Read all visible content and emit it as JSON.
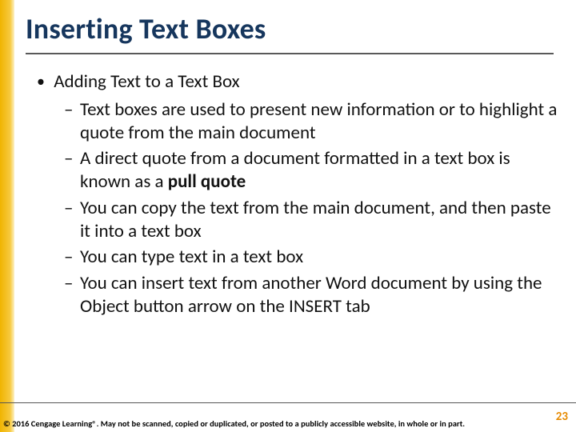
{
  "title": "Inserting Text Boxes",
  "content": {
    "l1": "Adding Text to a Text Box",
    "sub": [
      "Text boxes are used to present new information or to highlight a quote from the main document",
      "A direct quote from a document formatted in a text box is known as a ",
      "You can copy the text from the main document, and then paste it into a text box",
      "You can type text in a text box",
      "You can insert text from another Word document by using the Object button arrow on the INSERT tab"
    ],
    "bold_term": "pull quote"
  },
  "footer": "© 2016 Cengage Learning®. May not be scanned, copied or duplicated, or posted to a publicly accessible website, in whole or in part.",
  "page_number": "23"
}
